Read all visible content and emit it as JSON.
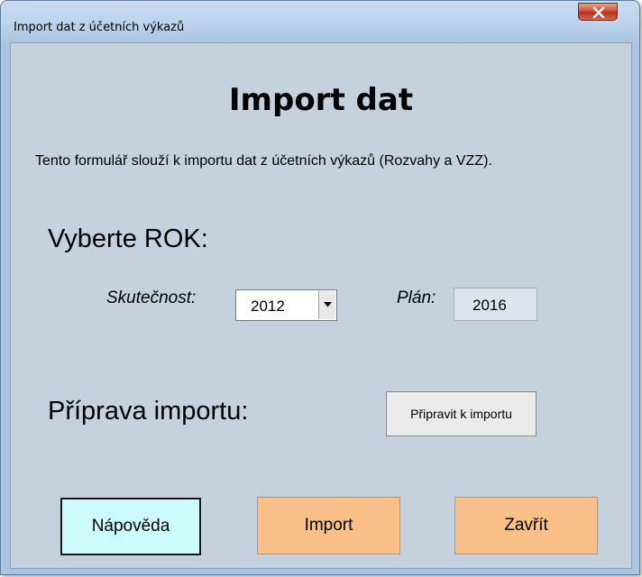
{
  "window": {
    "title": "Import dat z účetních výkazů"
  },
  "form": {
    "heading": "Import dat",
    "description": "Tento formulář slouží k importu dat z účetních výkazů (Rozvahy a VZZ).",
    "year_section_label": "Vyberte ROK:",
    "actual_label": "Skutečnost:",
    "actual_year": "2012",
    "plan_label": "Plán:",
    "plan_year": "2016",
    "prep_section_label": "Příprava importu:",
    "prepare_button": "Připravit k importu"
  },
  "buttons": {
    "help": "Nápověda",
    "import": "Import",
    "close": "Zavřít"
  },
  "colors": {
    "form_background": "#c5d1dd",
    "help_button": "#cdfcff",
    "action_button": "#fbbf8a",
    "close_window_button": "#c9432e"
  }
}
